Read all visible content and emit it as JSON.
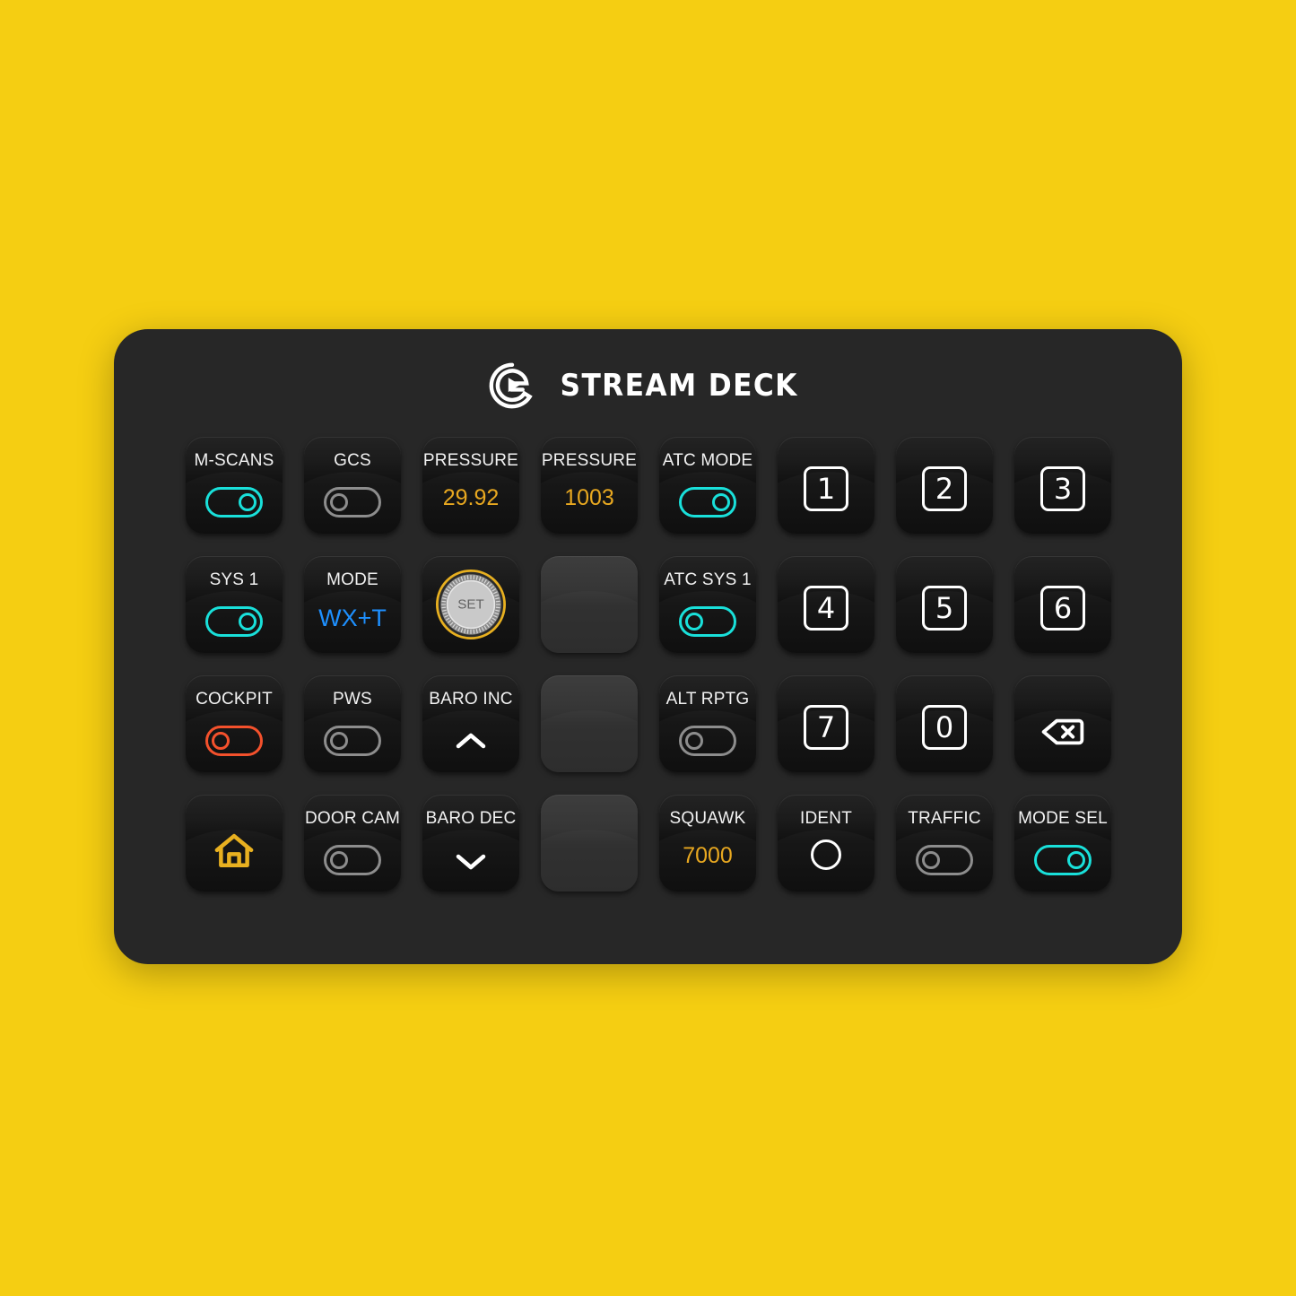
{
  "background_color": "#F5CE12",
  "device": {
    "body_color": "#272727",
    "brand": {
      "logo_icon": "elgato-logo-icon",
      "title": "STREAM DECK"
    }
  },
  "colors": {
    "toggle_on": "#19E0DA",
    "toggle_off": "#8D8D8D",
    "toggle_alert": "#F4512C",
    "value_amber": "#E8A820",
    "value_blue": "#1E90FF",
    "label_white": "#F2F2F2",
    "knob_ring": "#E8B020"
  },
  "keys": [
    {
      "id": "m-scans",
      "type": "toggle",
      "label": "M-SCANS",
      "state": "on",
      "knob_side": "right"
    },
    {
      "id": "gcs",
      "type": "toggle",
      "label": "GCS",
      "state": "off",
      "knob_side": "left"
    },
    {
      "id": "pressure-inhg",
      "type": "value",
      "label": "PRESSURE",
      "value": "29.92",
      "value_color": "amber"
    },
    {
      "id": "pressure-hpa",
      "type": "value",
      "label": "PRESSURE",
      "value": "1003",
      "value_color": "amber"
    },
    {
      "id": "atc-mode",
      "type": "toggle",
      "label": "ATC MODE",
      "state": "on",
      "knob_side": "right"
    },
    {
      "id": "num-1",
      "type": "digit",
      "label": "",
      "digit": "1"
    },
    {
      "id": "num-2",
      "type": "digit",
      "label": "",
      "digit": "2"
    },
    {
      "id": "num-3",
      "type": "digit",
      "label": "",
      "digit": "3"
    },
    {
      "id": "sys-1",
      "type": "toggle",
      "label": "SYS 1",
      "state": "on",
      "knob_side": "right"
    },
    {
      "id": "mode",
      "type": "value",
      "label": "MODE",
      "value": "WX+T",
      "value_color": "blue"
    },
    {
      "id": "set-knob",
      "type": "knob",
      "label": "",
      "knob_text": "SET"
    },
    {
      "id": "blank-r2",
      "type": "blank",
      "label": ""
    },
    {
      "id": "atc-sys-1",
      "type": "toggle",
      "label": "ATC SYS 1",
      "state": "on",
      "knob_side": "left"
    },
    {
      "id": "num-4",
      "type": "digit",
      "label": "",
      "digit": "4"
    },
    {
      "id": "num-5",
      "type": "digit",
      "label": "",
      "digit": "5"
    },
    {
      "id": "num-6",
      "type": "digit",
      "label": "",
      "digit": "6"
    },
    {
      "id": "cockpit",
      "type": "toggle",
      "label": "COCKPIT",
      "state": "alert",
      "knob_side": "left"
    },
    {
      "id": "pws",
      "type": "toggle",
      "label": "PWS",
      "state": "off",
      "knob_side": "left"
    },
    {
      "id": "baro-inc",
      "type": "icon",
      "label": "BARO INC",
      "icon": "chevron-up-icon"
    },
    {
      "id": "blank-r3",
      "type": "blank",
      "label": ""
    },
    {
      "id": "alt-rptg",
      "type": "toggle",
      "label": "ALT RPTG",
      "state": "off",
      "knob_side": "left"
    },
    {
      "id": "num-7",
      "type": "digit",
      "label": "",
      "digit": "7"
    },
    {
      "id": "num-0",
      "type": "digit",
      "label": "",
      "digit": "0"
    },
    {
      "id": "backspace",
      "type": "icon",
      "label": "",
      "icon": "backspace-icon"
    },
    {
      "id": "home",
      "type": "icon",
      "label": "",
      "icon": "home-icon"
    },
    {
      "id": "door-cam",
      "type": "toggle",
      "label": "DOOR CAM",
      "state": "off",
      "knob_side": "left"
    },
    {
      "id": "baro-dec",
      "type": "icon",
      "label": "BARO DEC",
      "icon": "chevron-down-icon"
    },
    {
      "id": "blank-r4",
      "type": "blank",
      "label": ""
    },
    {
      "id": "squawk",
      "type": "value",
      "label": "SQUAWK",
      "value": "7000",
      "value_color": "amber"
    },
    {
      "id": "ident",
      "type": "icon",
      "label": "IDENT",
      "icon": "circle-icon"
    },
    {
      "id": "traffic",
      "type": "toggle",
      "label": "TRAFFIC",
      "state": "off",
      "knob_side": "left"
    },
    {
      "id": "mode-sel",
      "type": "toggle",
      "label": "MODE SEL",
      "state": "on",
      "knob_side": "right"
    }
  ]
}
